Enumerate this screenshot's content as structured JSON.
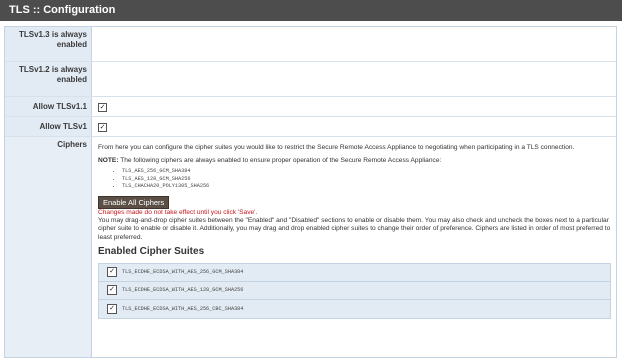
{
  "title": "TLS :: Configuration",
  "rows": {
    "tls13": {
      "label": "TLSv1.3 is always enabled"
    },
    "tls12": {
      "label": "TLSv1.2 is always enabled"
    },
    "tls11": {
      "label": "Allow TLSv1.1",
      "checked": true
    },
    "tls10": {
      "label": "Allow TLSv1",
      "checked": true
    },
    "ciphers": {
      "label": "Ciphers",
      "intro": "From here you can configure the cipher suites you would like to restrict the Secure Remote Access Appliance to negotiating when participating in a TLS connection.",
      "note_label": "NOTE:",
      "note_text": " The following ciphers are always enabled to ensure proper operation of the Secure Remote Access Appliance:",
      "always_enabled": [
        "TLS_AES_256_GCM_SHA384",
        "TLS_AES_128_GCM_SHA256",
        "TLS_CHACHA20_POLY1305_SHA256"
      ],
      "enable_all_label": "Enable All Ciphers",
      "warning": "Changes made do not take effect until you click 'Save'.",
      "help": "You may drag-and-drop cipher suites between the \"Enabled\" and \"Disabled\" sections to enable or disable them. You may also check and uncheck the boxes next to a particular cipher suite to enable or disable it. Additionally, you may drag and drop enabled cipher suites to change their order of preference. Ciphers are listed in order of most preferred to least preferred.",
      "enabled_heading": "Enabled Cipher Suites",
      "enabled_suites": [
        {
          "name": "TLS_ECDHE_ECDSA_WITH_AES_256_GCM_SHA384",
          "checked": true
        },
        {
          "name": "TLS_ECDHE_ECDSA_WITH_AES_128_GCM_SHA256",
          "checked": true
        },
        {
          "name": "TLS_ECDHE_ECDSA_WITH_AES_256_CBC_SHA384",
          "checked": true
        }
      ]
    }
  },
  "icons": {
    "checkbox": "checkbox-checked-icon",
    "bullet": "bullet-icon"
  },
  "colors": {
    "titlebar": "#4d4d4d",
    "label_bg": "#e2ebf4",
    "warning": "#c4161c",
    "button": "#5b4f46"
  }
}
